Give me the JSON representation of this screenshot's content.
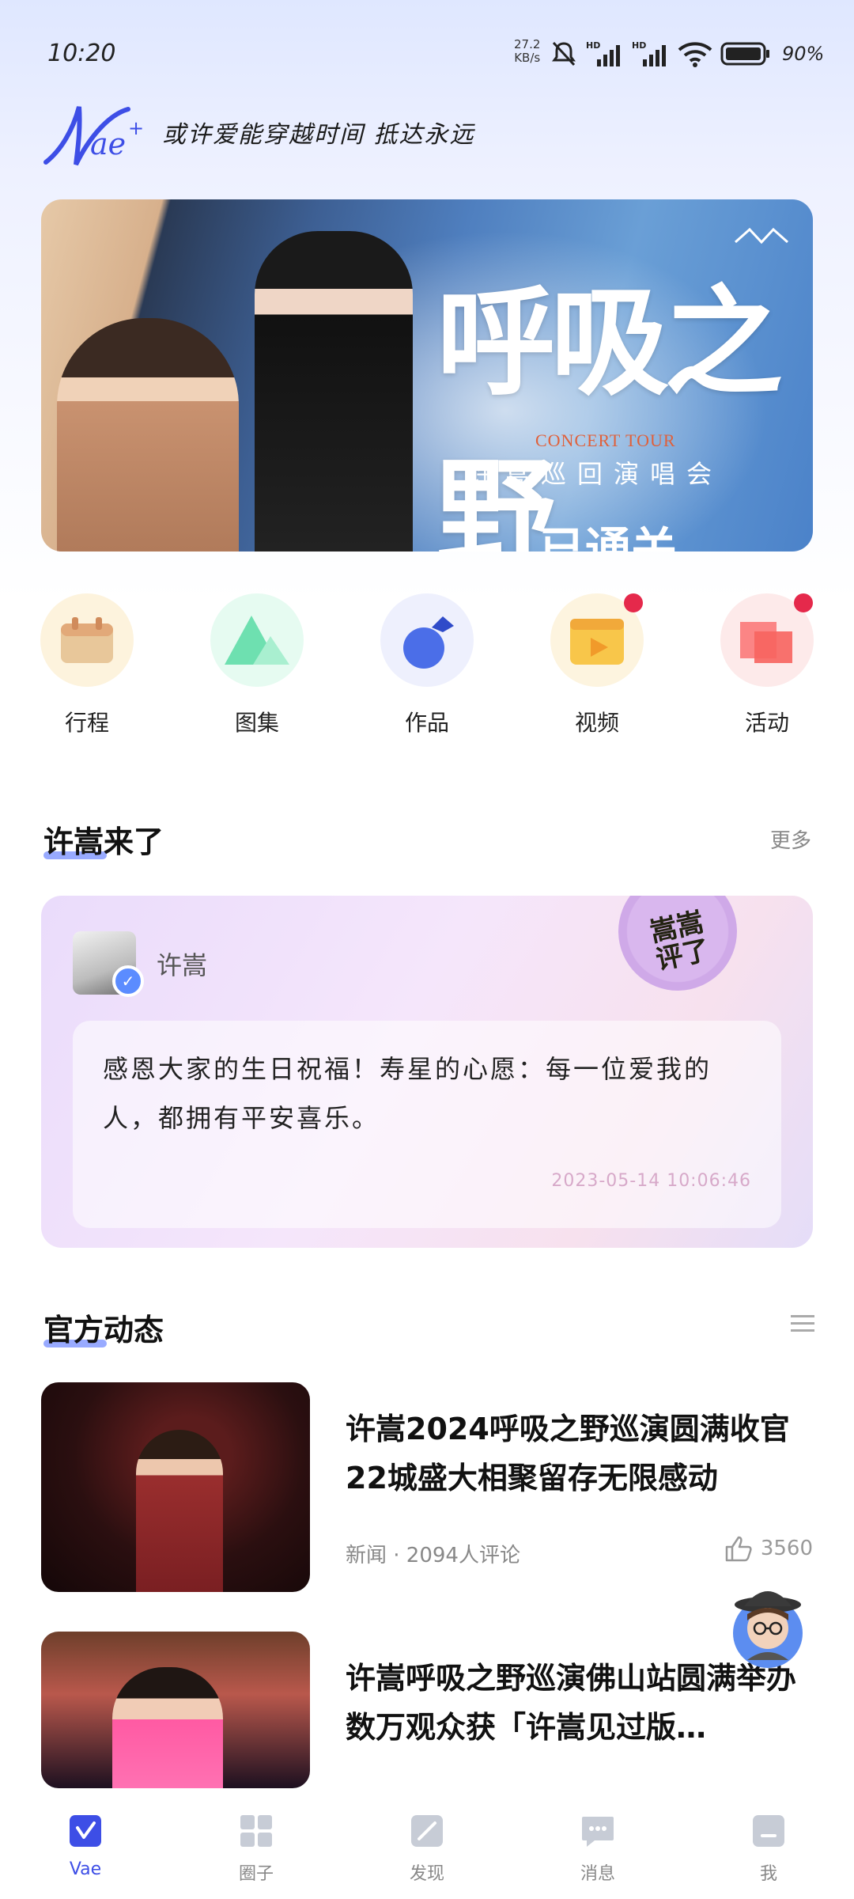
{
  "status_bar": {
    "time": "10:20",
    "net_speed_value": "27.2",
    "net_speed_unit": "KB/s",
    "battery": "90%"
  },
  "header": {
    "logo_text": "Vae",
    "slogan": "或许爱能穿越时间 抵达永远"
  },
  "banner": {
    "title": "呼吸之野",
    "subtitle_en": "CONCERT TOUR",
    "subtitle": "许嵩巡回演唱会",
    "bottom_text": "已通关"
  },
  "quick_links": [
    {
      "label": "行程",
      "icon": "schedule-icon",
      "color": "#f7e5c2",
      "dot": false
    },
    {
      "label": "图集",
      "icon": "gallery-icon",
      "color": "#d9f6e7",
      "dot": false
    },
    {
      "label": "作品",
      "icon": "music-icon",
      "color": "#e5e9fb",
      "dot": false
    },
    {
      "label": "视频",
      "icon": "video-icon",
      "color": "#fbeccb",
      "dot": true
    },
    {
      "label": "活动",
      "icon": "event-icon",
      "color": "#fce3e3",
      "dot": true
    }
  ],
  "section_post": {
    "title": "许嵩来了",
    "more": "更多"
  },
  "post_card": {
    "user": "许嵩",
    "stamp": "嵩嵩评了",
    "text": "感恩大家的生日祝福！寿星的心愿：每一位爱我的人，都拥有平安喜乐。",
    "time": "2023-05-14 10:06:46"
  },
  "section_news": {
    "title": "官方动态"
  },
  "news": [
    {
      "title": "许嵩2024呼吸之野巡演圆满收官 22城盛大相聚留存无限感动",
      "meta": "新闻 · 2094人评论",
      "likes": "3560"
    },
    {
      "title": "许嵩呼吸之野巡演佛山站圆满举办 数万观众获「许嵩见过版…",
      "meta": "",
      "likes": ""
    }
  ],
  "bottom_nav": [
    {
      "label": "Vae",
      "icon": "vae-home-icon",
      "active": true
    },
    {
      "label": "圈子",
      "icon": "grid-icon",
      "active": false
    },
    {
      "label": "发现",
      "icon": "discover-icon",
      "active": false
    },
    {
      "label": "消息",
      "icon": "message-icon",
      "active": false
    },
    {
      "label": "我",
      "icon": "profile-icon",
      "active": false
    }
  ],
  "colors": {
    "accent": "#3d4ee6",
    "badge": "#e5294b"
  }
}
